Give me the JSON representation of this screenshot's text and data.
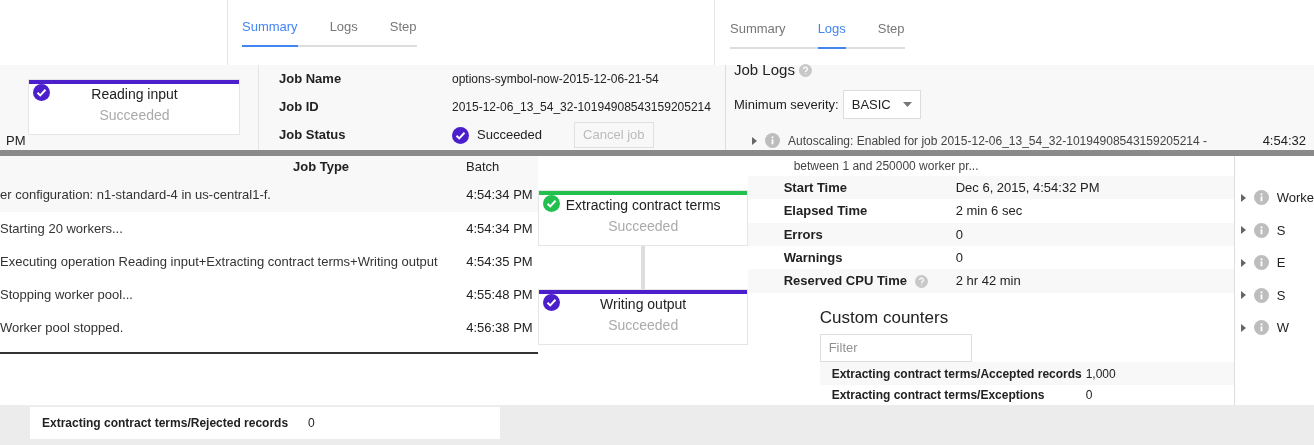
{
  "tabs_left": [
    {
      "label": "Summary",
      "selected": true
    },
    {
      "label": "Logs",
      "selected": false
    },
    {
      "label": "Step",
      "selected": false
    }
  ],
  "tabs_right": [
    {
      "label": "Summary",
      "selected": false
    },
    {
      "label": "Logs",
      "selected": true
    },
    {
      "label": "Step",
      "selected": false
    }
  ],
  "fragments": [
    "PM"
  ],
  "graph_nodes": [
    {
      "name": "Reading input",
      "status": "Succeeded",
      "color": "#4b1fcc"
    },
    {
      "name": "Extracting contract terms",
      "status": "Succeeded",
      "color": "#22c04e"
    },
    {
      "name": "Writing output",
      "status": "Succeeded",
      "color": "#4b1fcc"
    }
  ],
  "summary_rows": [
    {
      "label": "Job Name",
      "value": "options-symbol-now-2015-12-06-21-54"
    },
    {
      "label": "Job ID",
      "value": "2015-12-06_13_54_32-10194908543159205214"
    },
    {
      "label": "Job Status",
      "value": "Succeeded",
      "button": "Cancel job"
    },
    {
      "label": "Job Type",
      "value": "Batch"
    }
  ],
  "job_logs": {
    "title": "Job Logs",
    "severity_label": "Minimum severity:",
    "severity": "BASIC",
    "entry_line_1": "Autoscaling: Enabled for job 2015-12-06_13_54_32-10194908543159205214 -",
    "entry_line_2": "between 1 and 250000 worker pr...",
    "entry_time": "4:54:32"
  },
  "log_rows": [
    {
      "message": "er configuration: n1-standard-4 in us-central1-f.",
      "time": "4:54:34 PM"
    },
    {
      "message": "Starting 20 workers...",
      "time": "4:54:34 PM"
    },
    {
      "message": "Executing operation Reading input+Extracting contract terms+Writing output",
      "time": "4:54:35 PM"
    },
    {
      "message": "Stopping worker pool...",
      "time": "4:55:48 PM"
    },
    {
      "message": "Worker pool stopped.",
      "time": "4:56:38 PM"
    }
  ],
  "stats": [
    {
      "label": "Start Time",
      "value": "Dec 6, 2015, 4:54:32 PM",
      "help": false
    },
    {
      "label": "Elapsed Time",
      "value": "2 min 6 sec",
      "help": false
    },
    {
      "label": "Errors",
      "value": "0",
      "help": false
    },
    {
      "label": "Warnings",
      "value": "0",
      "help": false
    },
    {
      "label": "Reserved CPU Time",
      "value": "2 hr 42 min",
      "help": true
    }
  ],
  "side_log_items": [
    "Worke",
    "S",
    "E",
    "S",
    "W"
  ],
  "custom_counters": {
    "title": "Custom counters",
    "filter_placeholder": "Filter",
    "rows": [
      {
        "name": "Extracting contract terms/Accepted records",
        "value": "1,000"
      },
      {
        "name": "Extracting contract terms/Exceptions",
        "value": "0"
      },
      {
        "name": "Extracting contract terms/Rejected records",
        "value": "0"
      }
    ]
  }
}
